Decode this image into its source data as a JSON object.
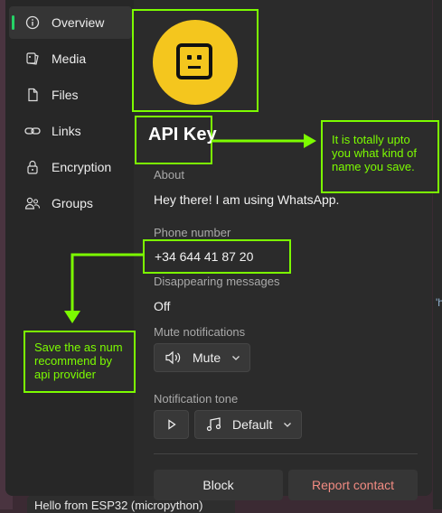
{
  "sidebar": {
    "items": [
      {
        "label": "Overview",
        "icon": "info-icon",
        "active": true
      },
      {
        "label": "Media",
        "icon": "media-icon",
        "active": false
      },
      {
        "label": "Files",
        "icon": "file-icon",
        "active": false
      },
      {
        "label": "Links",
        "icon": "link-icon",
        "active": false
      },
      {
        "label": "Encryption",
        "icon": "lock-icon",
        "active": false
      },
      {
        "label": "Groups",
        "icon": "groups-icon",
        "active": false
      }
    ]
  },
  "profile": {
    "name": "API Key",
    "about_label": "About",
    "about_value": "Hey there! I am using WhatsApp.",
    "phone_label": "Phone number",
    "phone_value": "+34 644 41 87 20",
    "disappearing_label": "Disappearing messages",
    "disappearing_value": "Off",
    "mute_label": "Mute notifications",
    "mute_button": "Mute",
    "tone_label": "Notification tone",
    "tone_value": "Default",
    "block_button": "Block",
    "report_button": "Report contact"
  },
  "annotations": {
    "name_note": "It is totally upto you what kind of name you save.",
    "phone_note": "Save the as  num recommend by api provider"
  },
  "background": {
    "message_preview": "Hello from ESP32 (micropython)",
    "edge_char": "'h"
  },
  "colors": {
    "accent": "#25d366",
    "annotation": "#7cfc00",
    "avatar": "#f4c61e",
    "report": "#f28b82"
  }
}
